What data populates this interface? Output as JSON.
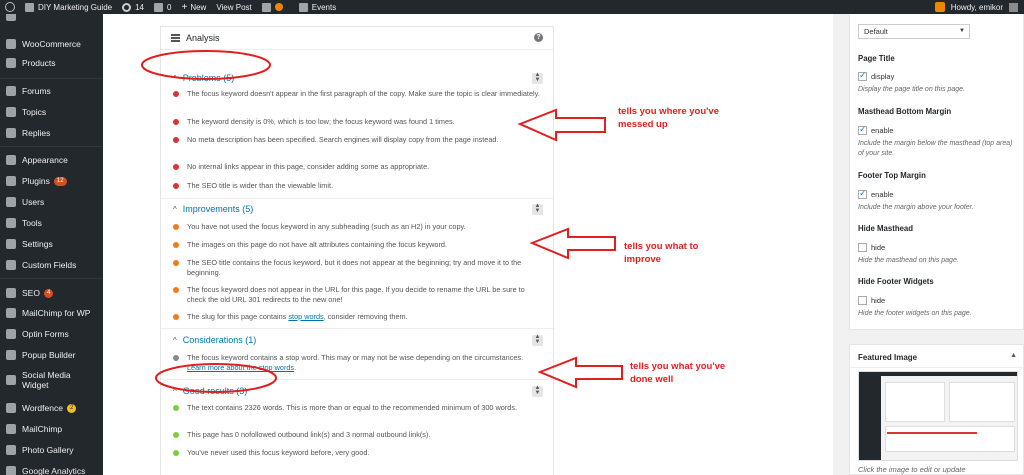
{
  "admin_bar": {
    "site_name": "DIY Marketing Guide",
    "updates_count": "14",
    "comments_count": "0",
    "new_label": "New",
    "view_post_label": "View Post",
    "events_label": "Events",
    "howdy": "Howdy, emikor"
  },
  "sidebar": {
    "items": [
      {
        "label": "WooCommerce"
      },
      {
        "label": "Products"
      },
      {
        "label": "Forums"
      },
      {
        "label": "Topics"
      },
      {
        "label": "Replies"
      },
      {
        "label": "Appearance"
      },
      {
        "label": "Plugins",
        "badge": "12"
      },
      {
        "label": "Users"
      },
      {
        "label": "Tools"
      },
      {
        "label": "Settings"
      },
      {
        "label": "Custom Fields"
      },
      {
        "label": "SEO",
        "badge": "4"
      },
      {
        "label": "MailChimp for WP"
      },
      {
        "label": "Optin Forms"
      },
      {
        "label": "Popup Builder"
      },
      {
        "label": "Social Media Widget"
      },
      {
        "label": "Wordfence",
        "badge": "2"
      },
      {
        "label": "MailChimp"
      },
      {
        "label": "Photo Gallery"
      },
      {
        "label": "Google Analytics"
      }
    ]
  },
  "analysis": {
    "title": "Analysis",
    "sections": [
      {
        "title": "Problems (5)",
        "color": "#dc3232",
        "items": [
          "The focus keyword doesn't appear in the first paragraph of the copy. Make sure the topic is clear immediately.",
          "The keyword density is 0%, which is too low; the focus keyword was found 1 times.",
          "No meta description has been specified. Search engines will display copy from the page instead.",
          "No internal links appear in this page, consider adding some as appropriate.",
          "The SEO title is wider than the viewable limit."
        ]
      },
      {
        "title": "Improvements (5)",
        "color": "#ee7c1b",
        "items": [
          "You have not used the focus keyword in any subheading (such as an H2) in your copy.",
          "The images on this page do not have alt attributes containing the focus keyword.",
          "The SEO title contains the focus keyword, but it does not appear at the beginning; try and move it to the beginning.",
          "The focus keyword does not appear in the URL for this page. If you decide to rename the URL be sure to check the old URL 301 redirects to the new one!"
        ],
        "last_item_prefix": "The slug for this page contains ",
        "last_item_link": "stop words",
        "last_item_suffix": ", consider removing them."
      },
      {
        "title": "Considerations (1)",
        "color": "#888888",
        "item_prefix": "The focus keyword contains a stop word. This may or may not be wise depending on the circumstances. ",
        "item_link": "Learn more about the stop words",
        "item_suffix": "."
      },
      {
        "title": "Good results (3)",
        "color": "#7ad03a",
        "items": [
          "The text contains 2326 words. This is more than or equal to the recommended minimum of 300 words.",
          "This page has 0 nofollowed outbound link(s) and 3 normal outbound link(s).",
          "You've never used this focus keyword before, very good."
        ]
      }
    ]
  },
  "annotations": {
    "messed_up": [
      "tells you where you've",
      "messed up"
    ],
    "improve": [
      "tells you what to",
      "improve"
    ],
    "done_well": [
      "tells you what you've",
      "done well"
    ],
    "color": "#e02020"
  },
  "page_options": {
    "template_value": "Default",
    "page_title_label": "Page Title",
    "page_title_option": "display",
    "page_title_desc": "Display the page title on this page.",
    "masthead_margin_label": "Masthead Bottom Margin",
    "masthead_margin_option": "enable",
    "masthead_margin_desc": "Include the margin below the masthead (top area) of your site.",
    "footer_margin_label": "Footer Top Margin",
    "footer_margin_option": "enable",
    "footer_margin_desc": "Include the margin above your footer.",
    "hide_masthead_label": "Hide Masthead",
    "hide_masthead_option": "hide",
    "hide_masthead_desc": "Hide the masthead on this page.",
    "hide_footer_label": "Hide Footer Widgets",
    "hide_footer_option": "hide",
    "hide_footer_desc": "Hide the footer widgets on this page."
  },
  "featured_image": {
    "title": "Featured Image",
    "caption": "Click the image to edit or update"
  }
}
